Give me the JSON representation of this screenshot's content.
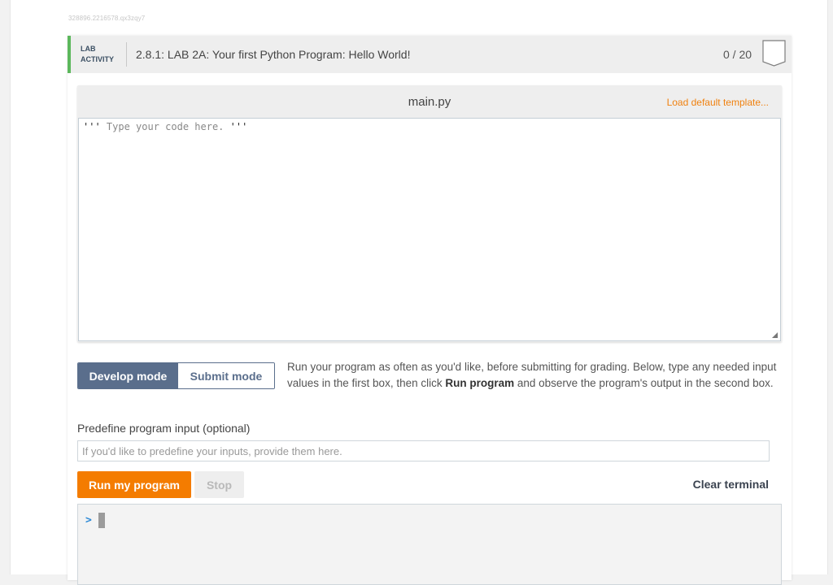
{
  "reference_id": "328896.2216578.qx3zqy7",
  "lab": {
    "tag_line1": "LAB",
    "tag_line2": "ACTIVITY",
    "title": "2.8.1: LAB 2A: Your first Python Program: Hello World!",
    "score": "0 / 20",
    "accent_color": "#5cb85c"
  },
  "editor": {
    "filename": "main.py",
    "load_template_label": "Load default template...",
    "code_quote_open": "'''",
    "code_comment": " Type your code here. ",
    "code_quote_close": "'''"
  },
  "modes": {
    "develop_label": "Develop mode",
    "submit_label": "Submit mode",
    "active": "Develop mode",
    "description_part1": "Run your program as often as you'd like, before submitting for grading. Below, type any needed input values in the first box, then click ",
    "description_bold": "Run program",
    "description_part2": " and observe the program's output in the second box."
  },
  "input": {
    "label": "Predefine program input (optional)",
    "value": "",
    "placeholder": "If you'd like to predefine your inputs, provide them here."
  },
  "controls": {
    "run_label": "Run my program",
    "stop_label": "Stop",
    "clear_label": "Clear terminal"
  },
  "terminal": {
    "prompt": ">"
  },
  "colors": {
    "run_button": "#f47c00",
    "mode_active": "#5a6e8c",
    "link_orange": "#f0810f",
    "prompt_blue": "#2e8ad6"
  }
}
